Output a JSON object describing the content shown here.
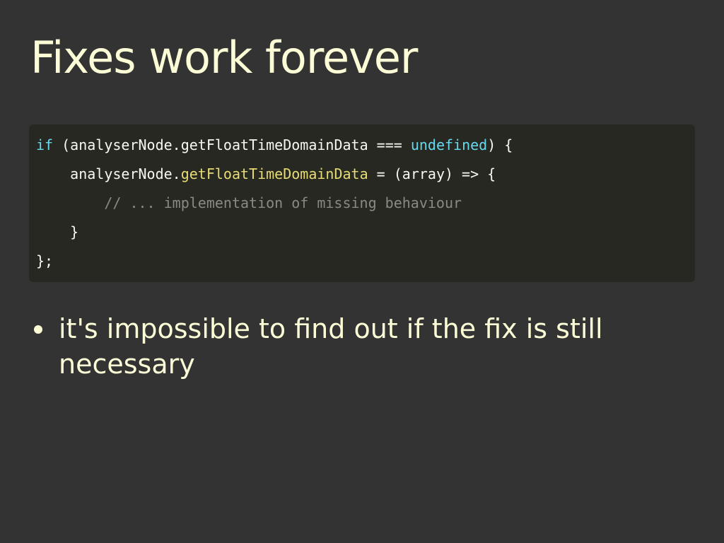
{
  "slide": {
    "title": "Fixes work forever"
  },
  "code": {
    "line1": {
      "kw": "if",
      "a": " (analyserNode.getFloatTimeDomainData === ",
      "builtin": "undefined",
      "b": ") {"
    },
    "line2": {
      "a": "    analyserNode.",
      "method": "getFloatTimeDomainData",
      "b": " = (array) => {"
    },
    "line3": {
      "indent": "        ",
      "comment": "// ... implementation of missing behaviour"
    },
    "line4": {
      "a": "    }"
    },
    "line5": {
      "a": "};"
    }
  },
  "bullets": [
    {
      "text": "it's impossible to find out if the fix is still necessary"
    }
  ],
  "colors": {
    "background": "#333333",
    "text": "#fcfcd6",
    "code_background": "#272822",
    "keyword": "#66d9ef",
    "method": "#e6db74",
    "comment": "#8a8a80"
  }
}
